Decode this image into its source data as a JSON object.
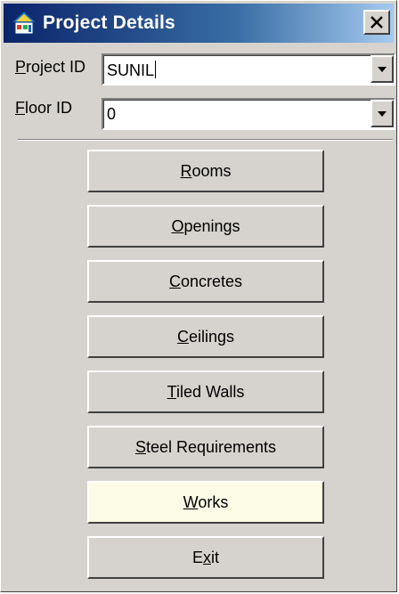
{
  "window": {
    "title": "Project Details",
    "close_glyph": "✕"
  },
  "fields": {
    "project_id": {
      "label_mnemonic": "P",
      "label_rest": "roject ID",
      "value": "SUNIL"
    },
    "floor_id": {
      "label_mnemonic": "F",
      "label_rest": "loor ID",
      "value": "0"
    }
  },
  "buttons": [
    {
      "pre": "",
      "mnemonic": "R",
      "post": "ooms",
      "label": "Rooms"
    },
    {
      "pre": "",
      "mnemonic": "O",
      "post": "penings",
      "label": "Openings"
    },
    {
      "pre": "",
      "mnemonic": "C",
      "post": "oncretes",
      "label": "Concretes"
    },
    {
      "pre": "",
      "mnemonic": "C",
      "post": "eilings",
      "label": "Ceilings"
    },
    {
      "pre": "",
      "mnemonic": "T",
      "post": "iled Walls",
      "label": "Tiled Walls"
    },
    {
      "pre": "",
      "mnemonic": "S",
      "post": "teel Requirements",
      "label": "Steel Requirements"
    },
    {
      "pre": "",
      "mnemonic": "W",
      "post": "orks",
      "label": "Works"
    },
    {
      "pre": "E",
      "mnemonic": "x",
      "post": "it",
      "label": "Exit"
    }
  ],
  "colors": {
    "title_start": "#0a246a",
    "title_end": "#a6caf0",
    "face": "#d6d3ce",
    "works_highlight": "#fbfbe6"
  },
  "icons": {
    "app": "project-app-icon",
    "close": "close-icon",
    "dropdown": "chevron-down-icon"
  }
}
